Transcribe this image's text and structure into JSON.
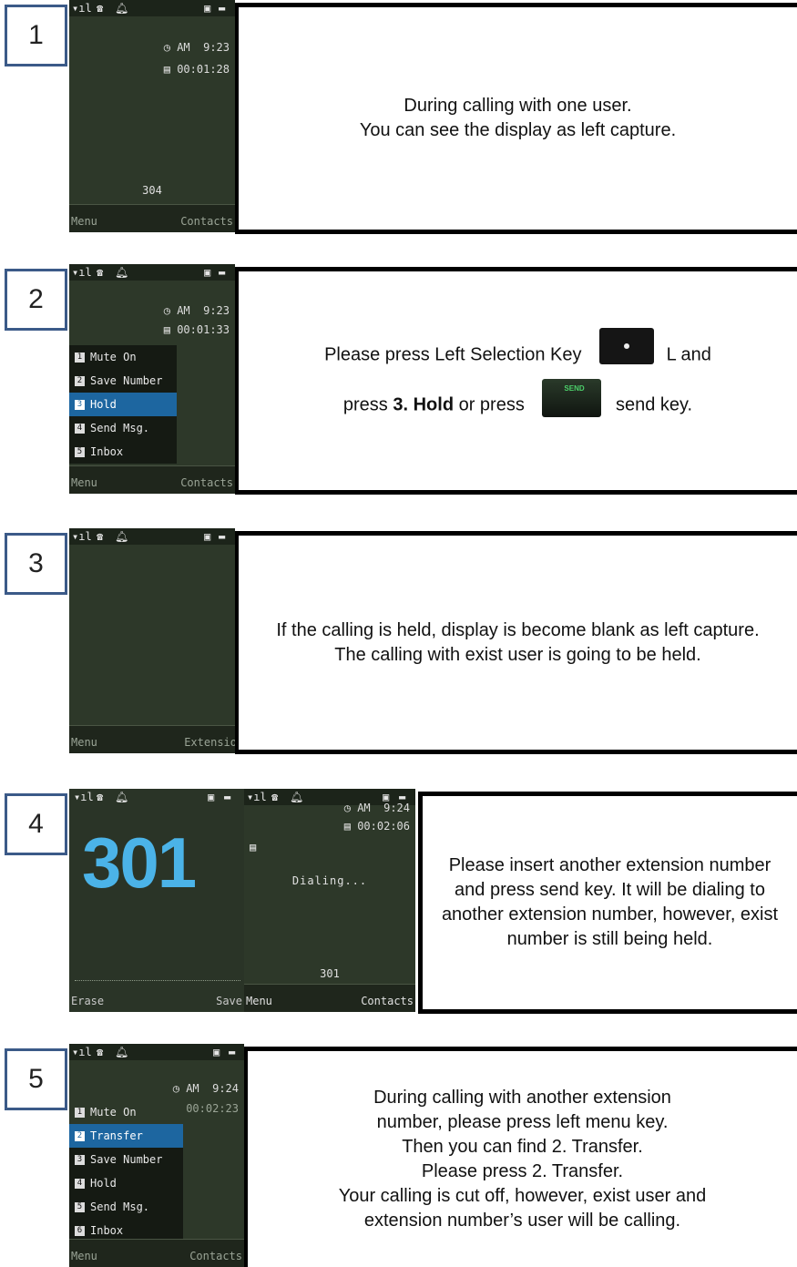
{
  "steps": [
    {
      "number": "1",
      "phone": {
        "time": "AM  9:23",
        "duration": "00:01:28",
        "center_number": "304",
        "soft_left": "Menu",
        "soft_right": "Contacts"
      },
      "text": [
        "During calling with one user.",
        "You can see the display as left capture."
      ]
    },
    {
      "number": "2",
      "phone": {
        "time": "AM  9:23",
        "duration": "00:01:33",
        "soft_left": "Menu",
        "soft_right": "Contacts",
        "menu": [
          "Mute On",
          "Save Number",
          "Hold",
          "Send Msg.",
          "Inbox"
        ],
        "selected_index": 2
      },
      "text_line1_a": "Please press Left  Selection Key",
      "text_line1_b": "L and",
      "text_line2_a": "press",
      "text_line2_bold": "3. Hold",
      "text_line2_b": "or press",
      "text_line2_c": "send key.",
      "send_key_label": "SEND"
    },
    {
      "number": "3",
      "phone": {
        "soft_left": "Menu",
        "soft_right": "Extensio"
      },
      "text": [
        "If the calling is held, display is become blank as left capture.",
        "The calling with exist user is going to be held."
      ]
    },
    {
      "number": "4",
      "phone_a": {
        "big_number": "301",
        "soft_left": "Erase",
        "soft_right": "Save"
      },
      "phone_b": {
        "time": "AM  9:24",
        "duration": "00:02:06",
        "status": "Dialing...",
        "center_number": "301",
        "soft_left": "Menu",
        "soft_right": "Contacts"
      },
      "text": [
        "Please insert another extension number and press send key. It will be dialing to another extension number, however, exist number is still being held."
      ]
    },
    {
      "number": "5",
      "phone": {
        "time": "AM  9:24",
        "duration": "00:02:23",
        "soft_left": "Menu",
        "soft_right": "Contacts",
        "menu": [
          "Mute On",
          "Transfer",
          "Save Number",
          "Hold",
          "Send Msg.",
          "Inbox"
        ],
        "selected_index": 1
      },
      "text": [
        "During calling with another extension",
        "number, please press left menu key.",
        "Then you can find 2. Transfer.",
        "Please press 2. Transfer.",
        "Your calling is cut off, however, exist user and",
        "extension number’s user will be calling."
      ]
    }
  ],
  "icons": [
    "signal-icon",
    "phone-icon",
    "bell-icon",
    "lock-icon",
    "battery-icon",
    "clock-icon",
    "timer-icon"
  ]
}
